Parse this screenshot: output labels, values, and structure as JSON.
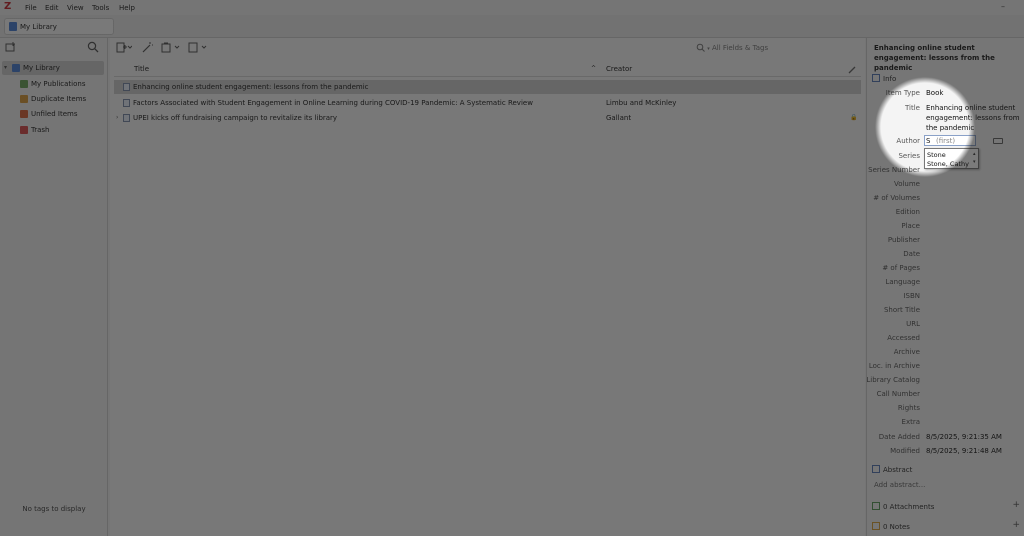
{
  "menubar": {
    "app_logo": "Z",
    "items": [
      "File",
      "Edit",
      "View",
      "Tools",
      "Help"
    ],
    "window_controls": [
      "–"
    ]
  },
  "tab": {
    "label": "My Library"
  },
  "collections": {
    "items": [
      {
        "label": "My Library",
        "selected": true,
        "icon": "library-icon"
      },
      {
        "label": "My Publications",
        "icon": "publications-icon"
      },
      {
        "label": "Duplicate Items",
        "icon": "duplicate-icon"
      },
      {
        "label": "Unfiled Items",
        "icon": "unfiled-icon"
      },
      {
        "label": "Trash",
        "icon": "trash-icon"
      }
    ],
    "tags_empty": "No tags to display"
  },
  "items_pane": {
    "search_placeholder": "All Fields & Tags",
    "columns": {
      "title": "Title",
      "creator": "Creator",
      "sort_indicator": "^"
    },
    "rows": [
      {
        "title": "Enhancing online student engagement: lessons from the pandemic",
        "creator": "",
        "selected": true,
        "expandable": false,
        "attachment": ""
      },
      {
        "title": "Factors Associated with Student Engagement in Online Learning during COVID-19 Pandemic: A Systematic Review",
        "creator": "Limbu and McKinley",
        "selected": false,
        "expandable": false,
        "attachment": ""
      },
      {
        "title": "UPEI kicks off fundraising campaign to revitalize its library",
        "creator": "Gallant",
        "selected": false,
        "expandable": true,
        "attachment": "🔒"
      }
    ]
  },
  "item_pane": {
    "header_title": "Enhancing online student engagement: lessons from the pandemic",
    "info_section": "Info",
    "fields": {
      "item_type": {
        "label": "Item Type",
        "value": "Book"
      },
      "title": {
        "label": "Title",
        "value_lines": [
          "Enhancing online student",
          "engagement: lessons from",
          "the pandemic"
        ]
      },
      "author": {
        "label": "Author",
        "typed": "S",
        "placeholder": "(first)"
      },
      "series": {
        "label": "Series"
      },
      "series_number": {
        "label": "Series Number"
      },
      "volume": {
        "label": "Volume"
      },
      "num_volumes": {
        "label": "# of Volumes"
      },
      "edition": {
        "label": "Edition"
      },
      "place": {
        "label": "Place"
      },
      "publisher": {
        "label": "Publisher"
      },
      "date": {
        "label": "Date"
      },
      "num_pages": {
        "label": "# of Pages"
      },
      "language": {
        "label": "Language"
      },
      "isbn": {
        "label": "ISBN"
      },
      "short_title": {
        "label": "Short Title"
      },
      "url": {
        "label": "URL"
      },
      "accessed": {
        "label": "Accessed"
      },
      "archive": {
        "label": "Archive"
      },
      "loc_in_archive": {
        "label": "Loc. in Archive"
      },
      "library_catalog": {
        "label": "Library Catalog"
      },
      "call_number": {
        "label": "Call Number"
      },
      "rights": {
        "label": "Rights"
      },
      "extra": {
        "label": "Extra"
      },
      "date_added": {
        "label": "Date Added",
        "value": "8/5/2025, 9:21:35 AM"
      },
      "modified": {
        "label": "Modified",
        "value": "8/5/2025, 9:21:48 AM"
      }
    },
    "autocomplete": [
      "Stone",
      "Stone, Cathy"
    ],
    "abstract_section": "Abstract",
    "abstract_placeholder": "Add abstract...",
    "attachments_section": "0 Attachments",
    "notes_section": "0 Notes"
  },
  "colors": {
    "accent_blue": "#4a7fd4",
    "logo_red": "#c4262e",
    "selected_row": "#cfcfcf",
    "overlay": "rgba(20,20,20,0.56)"
  }
}
